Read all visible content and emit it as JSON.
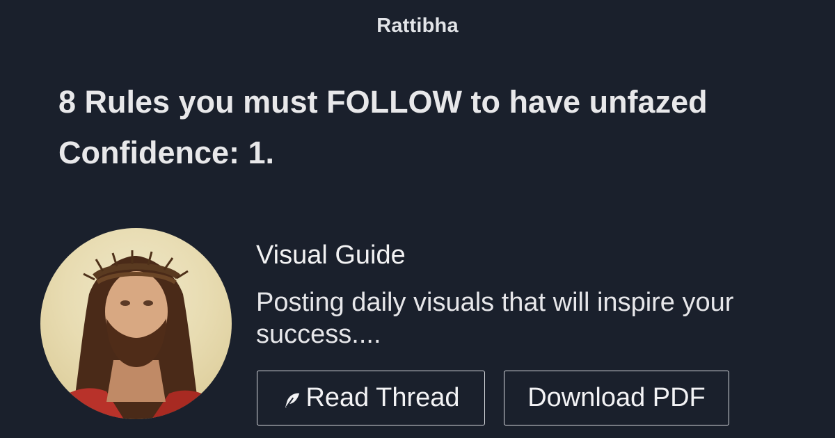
{
  "header": {
    "brand": "Rattibha"
  },
  "thread": {
    "title": "8 Rules you must FOLLOW to have unfazed Confidence: 1."
  },
  "author": {
    "name": "Visual Guide",
    "bio": "Posting daily visuals that will inspire your success....",
    "avatar_icon": "profile-avatar"
  },
  "actions": {
    "read_label": "Read Thread",
    "read_icon": "feather-icon",
    "pdf_label": "Download PDF"
  },
  "colors": {
    "background": "#1a202c",
    "text": "#e8e8ea",
    "button_border": "#d7d9de"
  }
}
